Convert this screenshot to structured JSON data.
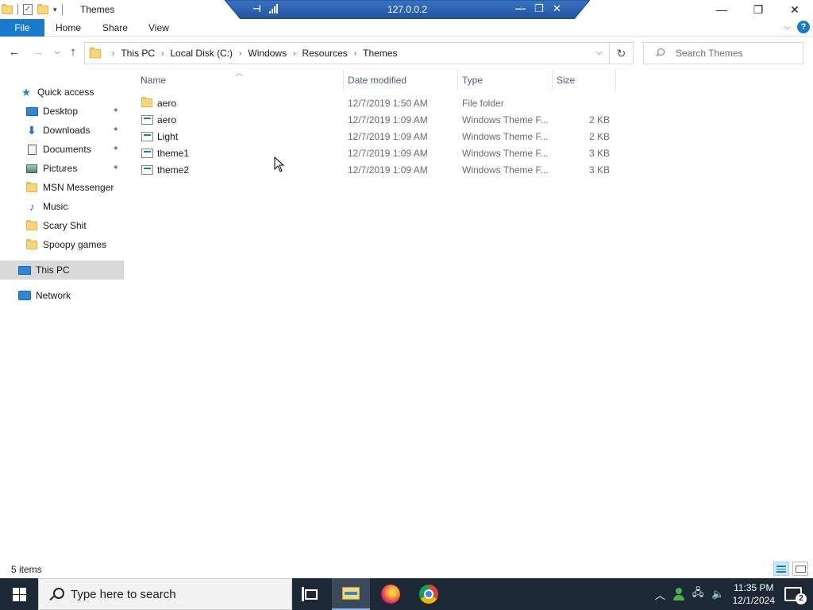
{
  "window": {
    "title": "Themes",
    "minimize": "—",
    "restore": "❐",
    "close": "✕"
  },
  "rdp": {
    "host": "127.0.0.2"
  },
  "ribbon": {
    "tabs": [
      "File",
      "Home",
      "Share",
      "View"
    ]
  },
  "address": {
    "crumbs": [
      "This PC",
      "Local Disk (C:)",
      "Windows",
      "Resources",
      "Themes"
    ]
  },
  "search": {
    "placeholder": "Search Themes"
  },
  "nav": {
    "items": [
      {
        "label": "Quick access",
        "icon": "star-icon"
      },
      {
        "label": "Desktop",
        "icon": "desktop-icon",
        "pinned": true
      },
      {
        "label": "Downloads",
        "icon": "download-icon",
        "pinned": true
      },
      {
        "label": "Documents",
        "icon": "documents-icon",
        "pinned": true
      },
      {
        "label": "Pictures",
        "icon": "pictures-icon",
        "pinned": true
      },
      {
        "label": "MSN Messenger",
        "icon": "folder-icon"
      },
      {
        "label": "Music",
        "icon": "music-icon"
      },
      {
        "label": "Scary Shit",
        "icon": "folder-icon"
      },
      {
        "label": "Spoopy games",
        "icon": "folder-icon"
      },
      {
        "label": "This PC",
        "icon": "computer-icon",
        "selected": true
      },
      {
        "label": "Network",
        "icon": "network-icon"
      }
    ]
  },
  "columns": {
    "name": "Name",
    "date": "Date modified",
    "type": "Type",
    "size": "Size"
  },
  "files": [
    {
      "name": "aero",
      "date": "12/7/2019 1:50 AM",
      "type": "File folder",
      "size": "",
      "icon": "folder-icon"
    },
    {
      "name": "aero",
      "date": "12/7/2019 1:09 AM",
      "type": "Windows Theme F...",
      "size": "2 KB",
      "icon": "theme-file-icon"
    },
    {
      "name": "Light",
      "date": "12/7/2019 1:09 AM",
      "type": "Windows Theme F...",
      "size": "2 KB",
      "icon": "theme-file-icon"
    },
    {
      "name": "theme1",
      "date": "12/7/2019 1:09 AM",
      "type": "Windows Theme F...",
      "size": "3 KB",
      "icon": "theme-file-icon"
    },
    {
      "name": "theme2",
      "date": "12/7/2019 1:09 AM",
      "type": "Windows Theme F...",
      "size": "3 KB",
      "icon": "theme-file-icon"
    }
  ],
  "status": {
    "count": "5 items"
  },
  "taskbar": {
    "search_text": "Type here to search",
    "time": "11:35 PM",
    "date": "12/1/2024",
    "notifications": "2"
  },
  "colors": {
    "accent": "#1979ca",
    "taskbar": "#1c2836",
    "rdp_bar": "#2a5ca8"
  }
}
